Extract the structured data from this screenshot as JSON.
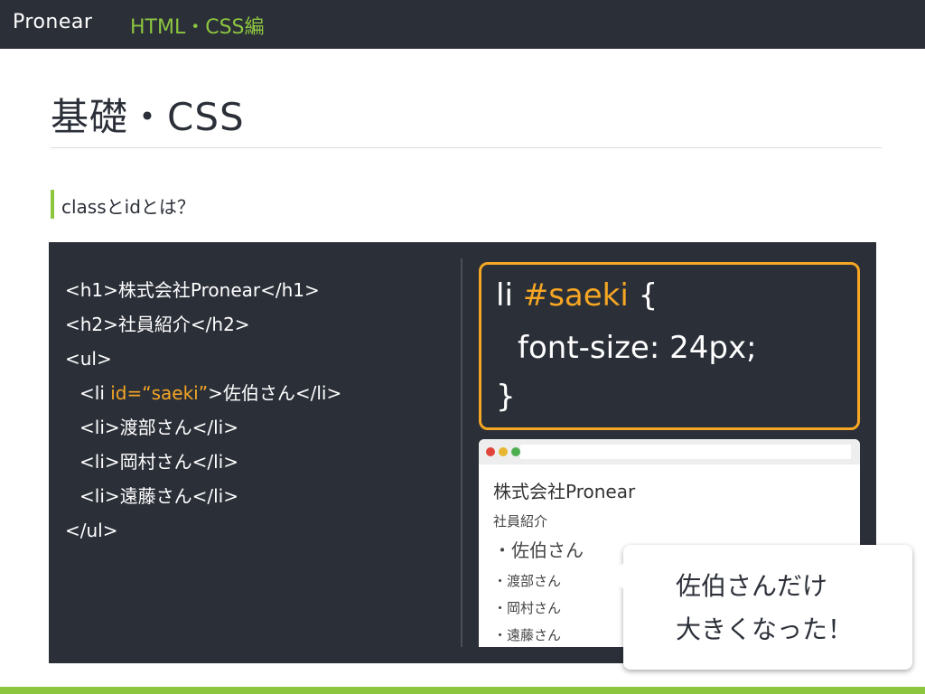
{
  "header": {
    "brand": "Pronear",
    "course": "HTML・CSS編"
  },
  "page": {
    "title": "基礎・CSS",
    "section_title": "classとidとは？"
  },
  "html_code": {
    "l1": "<h1>株式会社Pronear</h1>",
    "l2": "<h2>社員紹介</h2>",
    "l3": "<ul>",
    "l4_pre": "<li ",
    "l4_attr": "id=“saeki”",
    "l4_post": ">佐伯さん</li>",
    "l5": "<li>渡部さん</li>",
    "l6": "<li>岡村さん</li>",
    "l7": "<li>遠藤さん</li>",
    "l8": "</ul>"
  },
  "css_code": {
    "selector_tag": "li ",
    "selector_id": "#saeki",
    "open_brace": " {",
    "declaration": "font-size: 24px;",
    "close_brace": "}"
  },
  "browser_preview": {
    "h1": "株式会社Pronear",
    "h2": "社員紹介",
    "items": [
      "・佐伯さん",
      "・渡部さん",
      "・岡村さん",
      "・遠藤さん"
    ]
  },
  "callout": {
    "line1": "佐伯さんだけ",
    "line2": "大きくなった！"
  },
  "colors": {
    "dark": "#2b2f38",
    "accent_green": "#8cc63f",
    "accent_orange": "#f5a623"
  }
}
